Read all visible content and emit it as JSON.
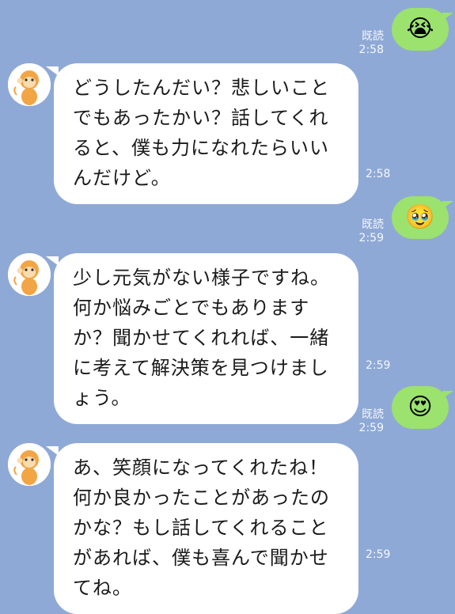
{
  "messages": [
    {
      "side": "out",
      "read_label": "既読",
      "time": "2:58",
      "emoji": "😭",
      "icon": "crying-face"
    },
    {
      "side": "in",
      "text": "どうしたんだい？悲しいことでもあったかい？話してくれると、僕も力になれたらいいんだけど。",
      "time": "2:58"
    },
    {
      "side": "out",
      "read_label": "既読",
      "time": "2:59",
      "emoji": "🥹",
      "icon": "holding-back-tears-face"
    },
    {
      "side": "in",
      "text": "少し元気がない様子ですね。何か悩みごとでもありますか？聞かせてくれれば、一緒に考えて解決策を見つけましょう。",
      "time": "2:59"
    },
    {
      "side": "out",
      "read_label": "既読",
      "time": "2:59",
      "emoji": "😍",
      "icon": "heart-eyes-face"
    },
    {
      "side": "in",
      "text": "あ、笑顔になってくれたね！何か良かったことがあったのかな？もし話してくれることがあれば、僕も喜んで聞かせてね。",
      "time": "2:59"
    }
  ],
  "colors": {
    "background": "#8fa9d6",
    "outgoing_bubble": "#9be26e",
    "incoming_bubble": "#ffffff"
  }
}
